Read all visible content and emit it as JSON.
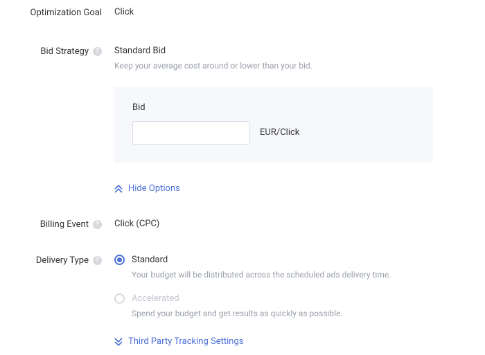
{
  "optimizationGoal": {
    "label": "Optimization Goal",
    "value": "Click"
  },
  "bidStrategy": {
    "label": "Bid Strategy",
    "value": "Standard Bid",
    "desc": "Keep your average cost around or lower than your bid.",
    "bidTitle": "Bid",
    "bidInputValue": "",
    "bidUnit": "EUR/Click"
  },
  "hideOptions": {
    "label": "Hide Options"
  },
  "billingEvent": {
    "label": "Billing Event",
    "value": "Click (CPC)"
  },
  "deliveryType": {
    "label": "Delivery Type",
    "options": {
      "standard": {
        "label": "Standard",
        "desc": "Your budget will be distributed across the scheduled ads delivery time."
      },
      "accelerated": {
        "label": "Accelerated",
        "desc": "Spend your budget and get results as quickly as possible."
      }
    }
  },
  "thirdParty": {
    "label": "Third Party Tracking Settings"
  },
  "colors": {
    "accent": "#4b6fd6"
  }
}
